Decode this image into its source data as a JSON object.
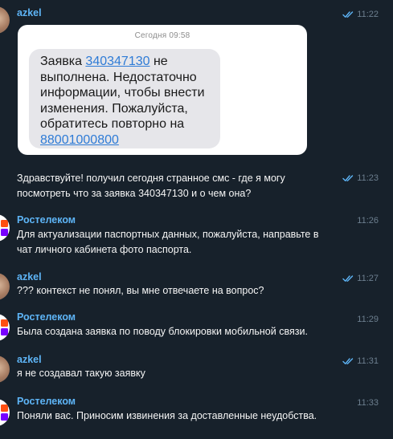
{
  "messages": [
    {
      "sender": "azkel",
      "time": "11:22",
      "attachment": {
        "date": "Сегодня 09:58",
        "text_part1": "Заявка ",
        "link1": "340347130",
        "text_part2": " не выполнена. Недостаточно информации, чтобы внести изменения. Пожалуйста, обратитесь повторно на ",
        "link2": "88001000800"
      }
    },
    {
      "time": "11:23",
      "lines": [
        "Здравствуйте! получил сегодня странное смс - где я могу",
        "посмотреть что за заявка 340347130 и о чем она?"
      ]
    },
    {
      "sender": "Ростелеком",
      "time": "11:26",
      "lines": [
        "Для актуализации паспортных данных, пожалуйста, направьте в",
        "чат личного кабинета фото паспорта."
      ]
    },
    {
      "sender": "azkel",
      "time": "11:27",
      "lines": [
        "??? контекст не понял, вы мне отвечаете на вопрос?"
      ]
    },
    {
      "sender": "Ростелеком",
      "time": "11:29",
      "lines": [
        "Была создана заявка по поводу блокировки мобильной связи."
      ]
    },
    {
      "sender": "azkel",
      "time": "11:31",
      "lines": [
        "я не создавал такую заявку"
      ]
    },
    {
      "sender": "Ростелеком",
      "time": "11:33",
      "lines": [
        "Поняли вас. Приносим извинения за доставленные неудобства."
      ]
    }
  ],
  "colors": {
    "background": "#17212b",
    "sender": "#5eb5f7",
    "time": "#6d7f8f",
    "read_check": "#5eb5f7",
    "link": "#2e7bd6"
  },
  "icons": {
    "read": "double-check-icon",
    "company_logo": "rostelecom-logo-icon"
  }
}
